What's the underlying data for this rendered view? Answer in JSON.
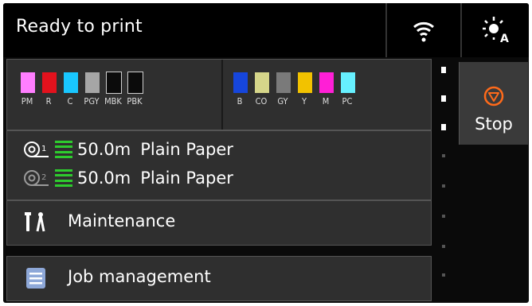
{
  "status_text": "Ready to print",
  "icons": {
    "wifi": "wifi-icon",
    "quiet_mode": "quiet-mode-icon",
    "stop": "stop-icon",
    "maintenance": "maintenance-tools-icon",
    "job_management": "job-list-icon",
    "roll": "roll-paper-icon"
  },
  "inks_left": [
    {
      "label": "PM",
      "color": "#ff7eff"
    },
    {
      "label": "R",
      "color": "#e3121d"
    },
    {
      "label": "C",
      "color": "#19c7ff"
    },
    {
      "label": "PGY",
      "color": "#a6a6a6"
    },
    {
      "label": "MBK",
      "color": "#0b0b0b"
    },
    {
      "label": "PBK",
      "color": "#0b0b0b"
    }
  ],
  "inks_right": [
    {
      "label": "B",
      "color": "#1646dc"
    },
    {
      "label": "CO",
      "color": "#d6d68a"
    },
    {
      "label": "GY",
      "color": "#7a7a7a"
    },
    {
      "label": "Y",
      "color": "#f2c200"
    },
    {
      "label": "M",
      "color": "#ff1fd6"
    },
    {
      "label": "PC",
      "color": "#66f0ff"
    }
  ],
  "paper": {
    "rolls": [
      {
        "roll_number": "1",
        "length": "50.0m",
        "type": "Plain Paper"
      },
      {
        "roll_number": "2",
        "length": "50.0m",
        "type": "Plain Paper"
      }
    ]
  },
  "menu": {
    "maintenance": "Maintenance",
    "job_management": "Job management"
  },
  "stop_label": "Stop",
  "colors": {
    "accent_stop": "#ff6a1a",
    "remaining_bar": "#2ecb2e"
  }
}
